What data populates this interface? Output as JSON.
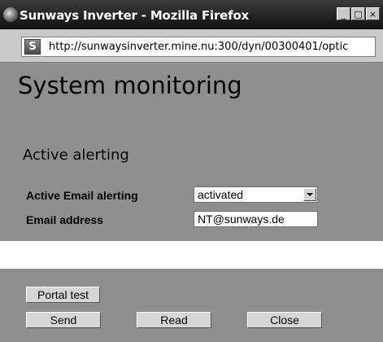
{
  "window": {
    "title": "Sunways Inverter - Mozilla Firefox",
    "minimize_label": "_",
    "maximize_label": "□",
    "close_label": "×"
  },
  "browser": {
    "site_icon_letter": "S",
    "url": "http://sunwaysinverter.mine.nu:300/dyn/00300401/optic"
  },
  "page": {
    "title": "System monitoring",
    "section_title": "Active alerting",
    "fields": {
      "email_alerting_label": "Active Email alerting",
      "email_alerting_value": "activated",
      "email_address_label": "Email address",
      "email_address_value": "NT@sunways.de"
    },
    "buttons": {
      "portal_test": "Portal test",
      "send": "Send",
      "read": "Read",
      "close": "Close"
    }
  },
  "icons": {
    "app": "firefox-icon",
    "site": "sunways-favicon",
    "bookmark": "star-icon",
    "dropdown": "chevron-down-icon"
  }
}
